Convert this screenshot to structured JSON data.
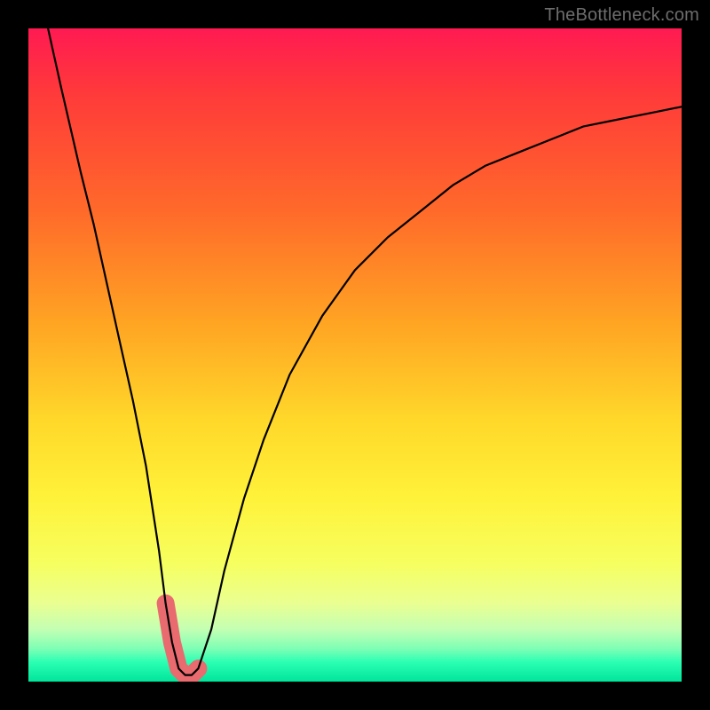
{
  "watermark": "TheBottleneck.com",
  "colors": {
    "page_bg": "#000000",
    "gradient_top": "#ff1a52",
    "gradient_bottom": "#00e59b",
    "curve": "#000000",
    "band": "#e96a6f",
    "watermark": "#6d6d6d"
  },
  "chart_data": {
    "type": "line",
    "title": "",
    "xlabel": "",
    "ylabel": "",
    "xlim": [
      0,
      100
    ],
    "ylim": [
      0,
      100
    ],
    "grid": false,
    "legend": false,
    "series": [
      {
        "name": "bottleneck-curve",
        "x": [
          3,
          5,
          8,
          10,
          12,
          14,
          16,
          18,
          20,
          21,
          22,
          23,
          24,
          25,
          26,
          28,
          30,
          33,
          36,
          40,
          45,
          50,
          55,
          60,
          65,
          70,
          75,
          80,
          85,
          90,
          95,
          100
        ],
        "values": [
          100,
          91,
          78,
          70,
          61,
          52,
          43,
          33,
          20,
          12,
          6,
          2,
          1,
          1,
          2,
          8,
          17,
          28,
          37,
          47,
          56,
          63,
          68,
          72,
          76,
          79,
          81,
          83,
          85,
          86,
          87,
          88
        ]
      },
      {
        "name": "highlight-band",
        "x": [
          21,
          22,
          23,
          24,
          25,
          26
        ],
        "values": [
          12,
          6,
          2,
          1,
          1,
          2
        ]
      }
    ],
    "notes": "Values estimated from pixel positions; y=0 at bottom (green), y=100 at top (red). Minimum of the curve is near x≈24, y≈1."
  }
}
